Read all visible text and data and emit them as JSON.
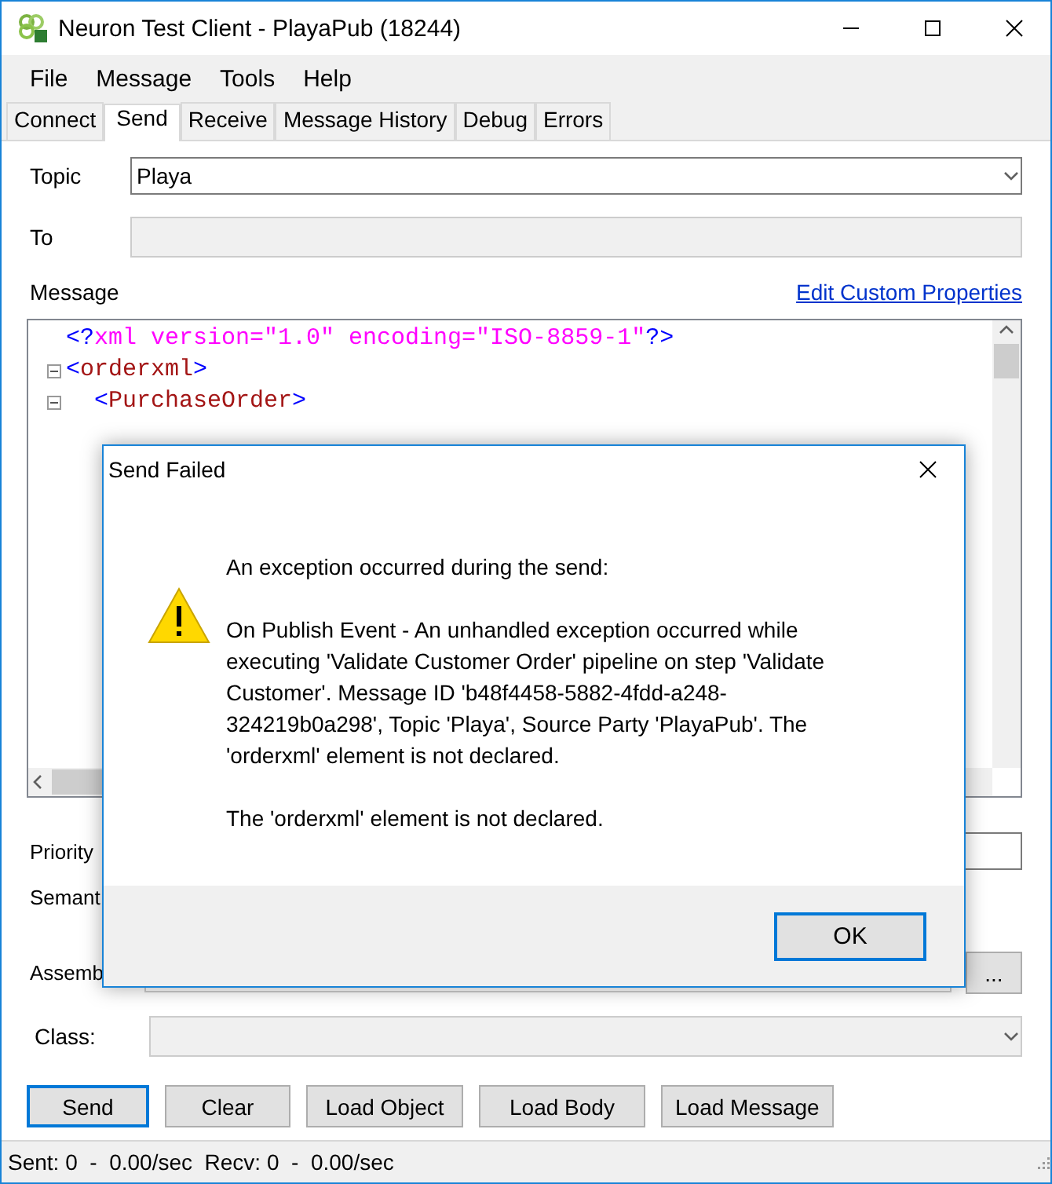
{
  "window": {
    "title": "Neuron Test Client - PlayaPub (18244)"
  },
  "menu": [
    "File",
    "Message",
    "Tools",
    "Help"
  ],
  "tabs": [
    {
      "label": "Connect",
      "selected": false
    },
    {
      "label": "Send",
      "selected": true
    },
    {
      "label": "Receive",
      "selected": false
    },
    {
      "label": "Message History",
      "selected": false
    },
    {
      "label": "Debug",
      "selected": false
    },
    {
      "label": "Errors",
      "selected": false
    }
  ],
  "topic": {
    "label": "Topic",
    "value": "Playa"
  },
  "to": {
    "label": "To",
    "disabled": true
  },
  "message": {
    "label": "Message",
    "link": "Edit Custom Properties",
    "lines": [
      {
        "foldable": false,
        "tokens": [
          {
            "kind": "bracket",
            "text": "<?"
          },
          {
            "kind": "pi",
            "text": "xml version=\"1.0\" encoding=\"ISO-8859-1\""
          },
          {
            "kind": "bracket",
            "text": "?>"
          }
        ]
      },
      {
        "foldable": true,
        "tokens": [
          {
            "kind": "bracket",
            "text": "<"
          },
          {
            "kind": "name",
            "text": "orderxml"
          },
          {
            "kind": "bracket",
            "text": ">"
          }
        ],
        "children": [
          {
            "foldable": true,
            "tokens": [
              {
                "kind": "bracket",
                "text": "<"
              },
              {
                "kind": "name",
                "text": "PurchaseOrder"
              },
              {
                "kind": "bracket",
                "text": ">"
              }
            ]
          }
        ]
      }
    ]
  },
  "priority": {
    "label": "Priority"
  },
  "semantic": {
    "label": "Semant"
  },
  "assembly": {
    "label": "Assemb",
    "browse": "..."
  },
  "class": {
    "label": "Class:",
    "disabled": true
  },
  "buttons": [
    {
      "label": "Send",
      "default": true
    },
    {
      "label": "Clear",
      "default": false
    },
    {
      "label": "Load Object",
      "default": false
    },
    {
      "label": "Load Body",
      "default": false
    },
    {
      "label": "Load Message",
      "default": false
    }
  ],
  "status_bar": "Sent: 0  -  0.00/sec  Recv: 0  -  0.00/sec",
  "dialog": {
    "title": "Send Failed",
    "paragraphs": [
      "An exception occurred during the send:",
      "On Publish Event - An unhandled exception occurred while executing 'Validate Customer Order' pipeline on step 'Validate Customer'. Message ID 'b48f4458-5882-4fdd-a248-324219b0a298', Topic 'Playa', Source Party 'PlayaPub'. The 'orderxml' element is not declared.",
      "The 'orderxml' element is not declared."
    ],
    "button": "OK"
  }
}
